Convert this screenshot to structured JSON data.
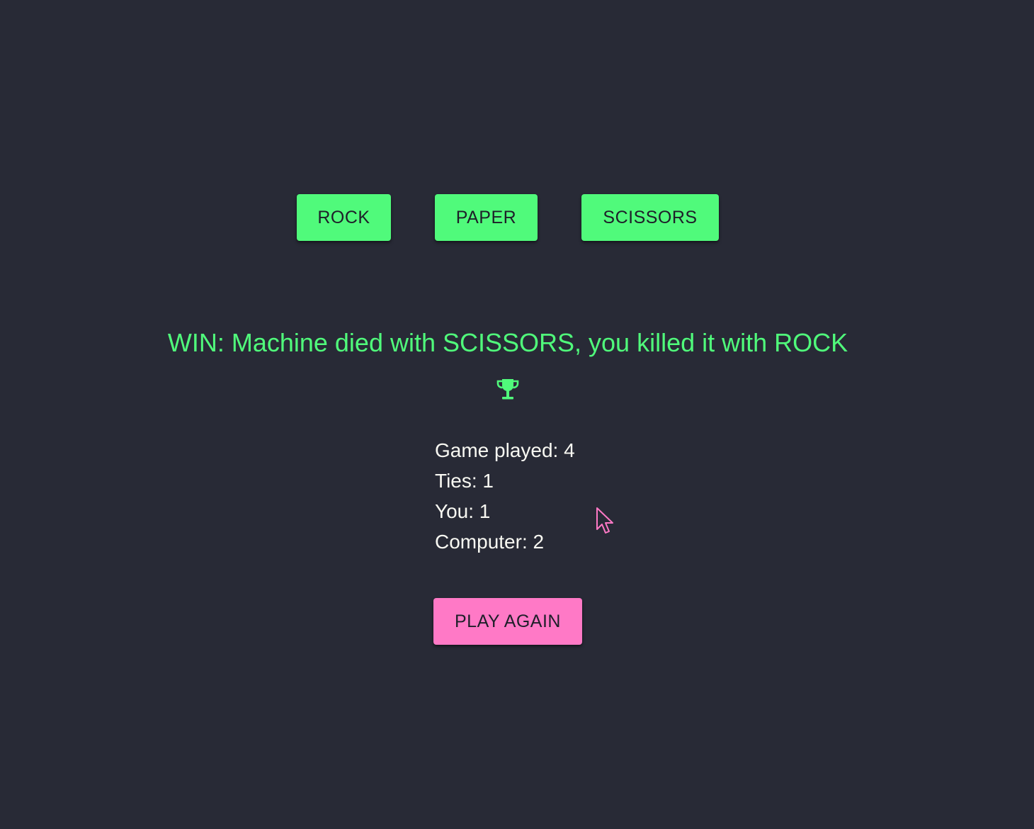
{
  "choices": {
    "rock": "ROCK",
    "paper": "PAPER",
    "scissors": "SCISSORS"
  },
  "result": {
    "message": "WIN: Machine died with SCISSORS, you killed it with ROCK",
    "icon": "trophy-icon"
  },
  "stats": {
    "games_played": "Game played: 4",
    "ties": "Ties: 1",
    "you": "You: 1",
    "computer": "Computer: 2"
  },
  "play_again_label": "PLAY AGAIN",
  "colors": {
    "background": "#282a36",
    "accent_green": "#50fa7b",
    "accent_pink": "#ff79c6",
    "text": "#f8f8f2"
  }
}
